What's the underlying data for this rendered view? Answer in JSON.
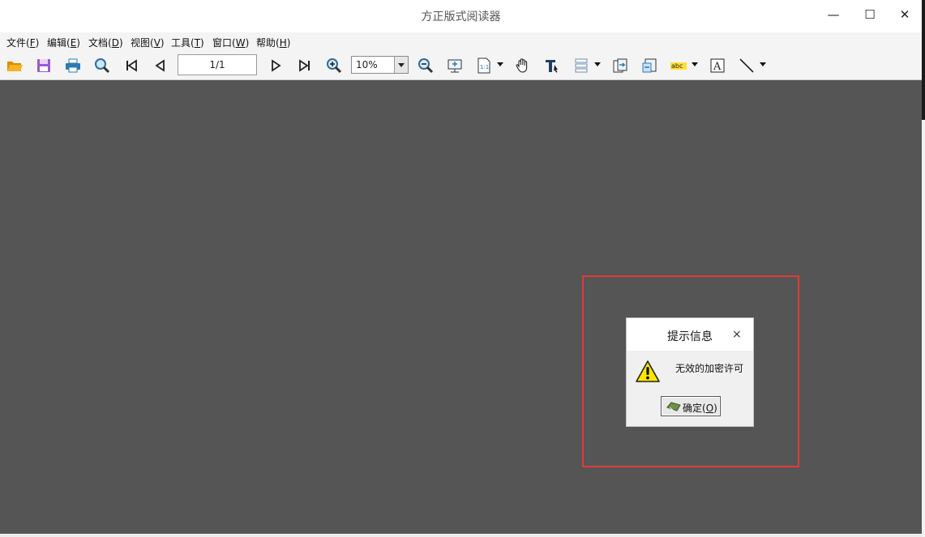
{
  "window": {
    "title": "方正版式阅读器",
    "controls": {
      "minimize": "—",
      "maximize": "☐",
      "close": "✕"
    }
  },
  "menubar": {
    "items": [
      {
        "label": "文件(",
        "key": "F",
        "suffix": ")"
      },
      {
        "label": "编辑(",
        "key": "E",
        "suffix": ")"
      },
      {
        "label": "文档(",
        "key": "D",
        "suffix": ")"
      },
      {
        "label": "视图(",
        "key": "V",
        "suffix": ")"
      },
      {
        "label": "工具(",
        "key": "T",
        "suffix": ")"
      },
      {
        "label": "窗口(",
        "key": "W",
        "suffix": ")"
      },
      {
        "label": "帮助(",
        "key": "H",
        "suffix": ")"
      }
    ]
  },
  "toolbar": {
    "icons": [
      "open-folder-icon",
      "save-icon",
      "print-icon",
      "search-icon",
      "first-page-icon",
      "previous-page-icon",
      "next-page-icon",
      "last-page-icon",
      "zoom-in-icon",
      "zoom-out-icon",
      "fit-screen-icon",
      "actual-size-icon",
      "hand-tool-icon",
      "text-select-icon",
      "page-layout-icon",
      "extract-page-icon",
      "insert-page-icon",
      "highlight-text-icon",
      "textbox-icon",
      "line-tool-icon"
    ],
    "page_indicator": "1/1",
    "zoom_value": "10%",
    "highlight_label": "abc",
    "textbox_label": "A",
    "actual_size_label": "1:1",
    "colors": {
      "open": "#e8a317",
      "save": "#9b59d0",
      "print": "#2a7ab8"
    }
  },
  "dialog": {
    "title": "提示信息",
    "close": "×",
    "message": "无效的加密许可",
    "ok_label": "确定(",
    "ok_key": "O",
    "ok_suffix": ")",
    "icon": "warning-icon"
  },
  "annotation": {
    "color": "#e53935"
  }
}
